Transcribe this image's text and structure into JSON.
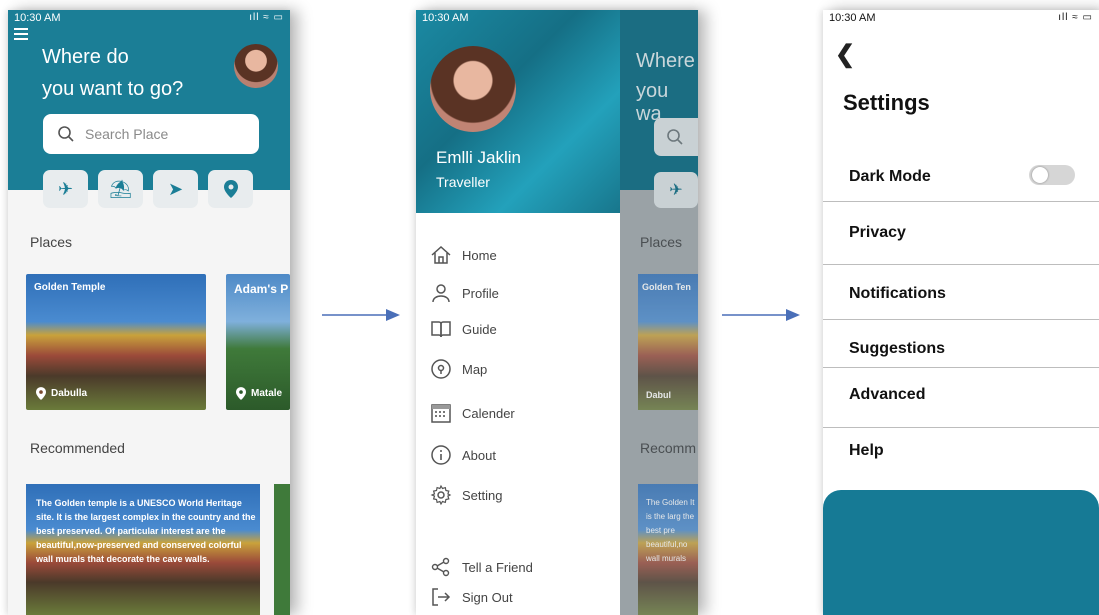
{
  "colors": {
    "teal": "#1b7e96",
    "arrow": "#4a6fb8",
    "panel": "#167a95"
  },
  "status": {
    "time": "10:30 AM",
    "signal": "ıll ≈ ▭"
  },
  "home": {
    "question_line1": "Where do",
    "question_line2": "you want to go?",
    "search_placeholder": "Search Place",
    "category_icons": [
      "airplane-icon",
      "beach-umbrella-icon",
      "navigation-arrow-icon",
      "location-pin-icon"
    ],
    "places_heading": "Places",
    "places": [
      {
        "title": "Golden Temple",
        "location": "Dabulla"
      },
      {
        "title": "Adam's P",
        "location": "Matale"
      }
    ],
    "recommended_heading": "Recommended",
    "recommended_text": "The Golden temple is a UNESCO World Heritage site. It is the largest complex in the country and the best preserved. Of particular interest are the beautiful,now-preserved and conserved colorful wall murals that decorate the cave walls."
  },
  "drawer": {
    "user_name": "Emlli Jaklin",
    "user_role": "Traveller",
    "menu": [
      {
        "label": "Home",
        "icon": "home-icon"
      },
      {
        "label": "Profile",
        "icon": "profile-icon"
      },
      {
        "label": "Guide",
        "icon": "book-icon"
      },
      {
        "label": "Map",
        "icon": "map-pin-icon"
      },
      {
        "label": "Calender",
        "icon": "calendar-icon"
      },
      {
        "label": "About",
        "icon": "info-icon"
      },
      {
        "label": "Setting",
        "icon": "gear-icon"
      }
    ],
    "footer": [
      {
        "label": "Tell a Friend",
        "icon": "share-icon"
      },
      {
        "label": "Sign Out",
        "icon": "sign-out-icon"
      }
    ],
    "under_text_1": "Where",
    "under_text_2": "you wa",
    "under_places": "Places",
    "under_card_title": "Golden Ten",
    "under_card_loc": "Dabul",
    "under_recommended": "Recomm",
    "under_desc": "The Golden It is the larg the best pre beautiful,no wall murals"
  },
  "settings": {
    "back_icon": "chevron-left-icon",
    "title": "Settings",
    "items": [
      "Dark Mode",
      "Privacy",
      "Notifications",
      "Suggestions",
      "Advanced",
      "Help"
    ],
    "dark_mode_enabled": false
  }
}
